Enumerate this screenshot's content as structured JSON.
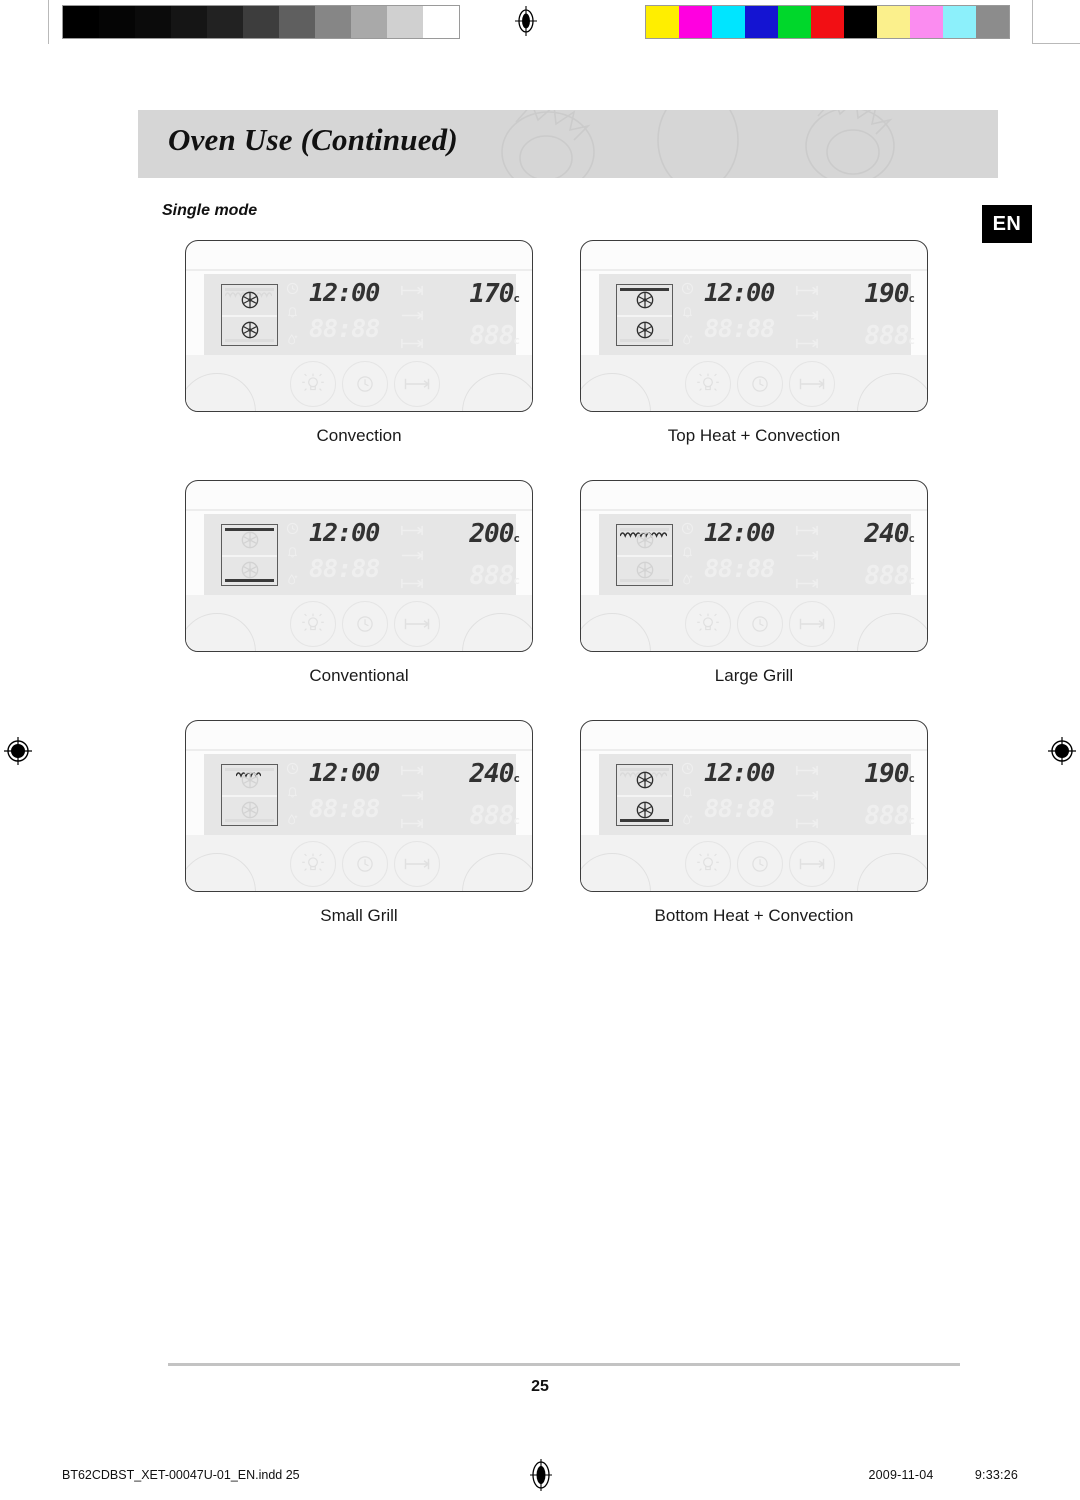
{
  "document": {
    "header_title": "Oven Use (Continued)",
    "section_title": "Single mode",
    "language_tab": "EN",
    "page_number": "25"
  },
  "footer": {
    "file_name": "BT62CDBST_XET-00047U-01_EN.indd   25",
    "date": "2009-11-04",
    "time": "9:33:26"
  },
  "modes": [
    {
      "caption": "Convection",
      "time": "12:00",
      "time_ghost": "88:88",
      "temperature": "170",
      "temperature_ghost": "888",
      "unit_c": "c",
      "unit_f": "f",
      "icon": "convection-icon",
      "top_heat": "off",
      "bottom_heat": "off",
      "fan_top": "on",
      "fan_bottom": "on",
      "grill": "none"
    },
    {
      "caption": "Top Heat + Convection",
      "time": "12:00",
      "time_ghost": "88:88",
      "temperature": "190",
      "temperature_ghost": "888",
      "unit_c": "c",
      "unit_f": "f",
      "icon": "top-heat-convection-icon",
      "top_heat": "on",
      "bottom_heat": "off",
      "fan_top": "on",
      "fan_bottom": "on",
      "grill": "none"
    },
    {
      "caption": "Conventional",
      "time": "12:00",
      "time_ghost": "88:88",
      "temperature": "200",
      "temperature_ghost": "888",
      "unit_c": "c",
      "unit_f": "f",
      "icon": "conventional-icon",
      "top_heat": "on",
      "bottom_heat": "on",
      "fan_top": "off",
      "fan_bottom": "off",
      "grill": "none"
    },
    {
      "caption": "Large Grill",
      "time": "12:00",
      "time_ghost": "88:88",
      "temperature": "240",
      "temperature_ghost": "888",
      "unit_c": "c",
      "unit_f": "f",
      "icon": "large-grill-icon",
      "top_heat": "off",
      "bottom_heat": "off",
      "fan_top": "off",
      "fan_bottom": "off",
      "grill": "large"
    },
    {
      "caption": "Small Grill",
      "time": "12:00",
      "time_ghost": "88:88",
      "temperature": "240",
      "temperature_ghost": "888",
      "unit_c": "c",
      "unit_f": "f",
      "icon": "small-grill-icon",
      "top_heat": "off",
      "bottom_heat": "off",
      "fan_top": "off",
      "fan_bottom": "off",
      "grill": "small"
    },
    {
      "caption": "Bottom Heat + Convection",
      "time": "12:00",
      "time_ghost": "88:88",
      "temperature": "190",
      "temperature_ghost": "888",
      "unit_c": "c",
      "unit_f": "f",
      "icon": "bottom-heat-convection-icon",
      "top_heat": "off",
      "bottom_heat": "on",
      "fan_top": "on",
      "fan_bottom": "on",
      "grill": "none"
    }
  ],
  "lcd_indicators": [
    "clock-icon",
    "bell-icon",
    "defrost-icon",
    "lock-icon"
  ],
  "lcd_markers": [
    "cooking-duration-marker-icon",
    "end-time-marker-icon"
  ],
  "panel_buttons": [
    "selector-dial-left",
    "lamp-icon",
    "clock-icon",
    "timer-icon",
    "selector-dial-right"
  ],
  "calibration": {
    "grayscale": [
      "#000000",
      "#050505",
      "#0b0b0b",
      "#151515",
      "#222222",
      "#3d3d3d",
      "#5f5f5f",
      "#868686",
      "#a9a9a9",
      "#d0d0d0",
      "#ffffff"
    ],
    "colors": [
      "#ffee00",
      "#ff00e0",
      "#00e5ff",
      "#1414d2",
      "#00d72b",
      "#f20f14",
      "#000000",
      "#fbf08c",
      "#fb8cf0",
      "#8cf0fb",
      "#8c8c8c"
    ]
  }
}
